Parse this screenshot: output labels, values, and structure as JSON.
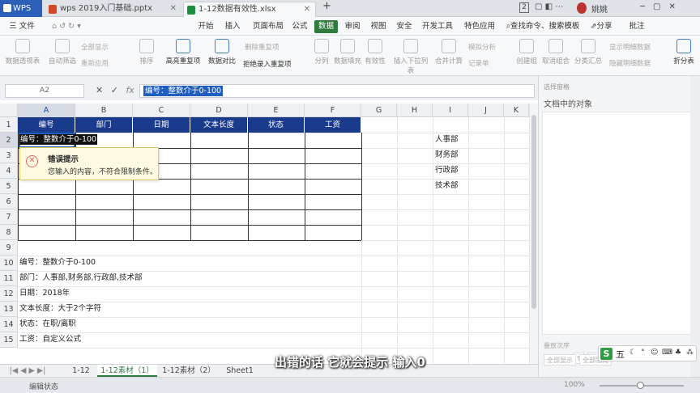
{
  "titlebar": {
    "logo": "WPS",
    "tabs": [
      {
        "label": "wps 2019入门基础.pptx",
        "icon": "presentation-file-icon",
        "color": "#d24726"
      },
      {
        "label": "1-12数据有效性.xlsx",
        "icon": "spreadsheet-file-icon",
        "color": "#1e8e3e"
      }
    ],
    "new_tab": "+",
    "page_badge": "2",
    "user": "姚姚"
  },
  "menubar": {
    "file": "三 文件",
    "items": [
      "开始",
      "插入",
      "页面布局",
      "公式",
      "数据",
      "审阅",
      "视图",
      "安全",
      "开发工具",
      "特色应用"
    ],
    "active": "数据",
    "search": "查找命令、搜索模板",
    "share": "分享",
    "annotate": "批注"
  },
  "ribbon": {
    "buttons": [
      {
        "label": "数据透视表",
        "enabled": false
      },
      {
        "label": "自动筛选",
        "enabled": false
      },
      {
        "label": "排序",
        "enabled": false
      },
      {
        "label": "高亮重复项",
        "enabled": true
      },
      {
        "label": "数据对比",
        "enabled": true
      },
      {
        "label": "拒绝录入重复项",
        "enabled": true
      },
      {
        "label": "分列",
        "enabled": false
      },
      {
        "label": "数据填充",
        "enabled": false
      },
      {
        "label": "有效性",
        "enabled": false
      },
      {
        "label": "插入下拉列表",
        "enabled": false
      },
      {
        "label": "合并计算",
        "enabled": false
      },
      {
        "label": "记录单",
        "enabled": false
      },
      {
        "label": "创建组",
        "enabled": false
      },
      {
        "label": "取消组合",
        "enabled": false
      },
      {
        "label": "分类汇总",
        "enabled": false
      },
      {
        "label": "折分表",
        "enabled": true
      }
    ],
    "small": [
      "全部显示",
      "重新应用",
      "删除重复项",
      "模拟分析",
      "显示明细数据",
      "隐藏明细数据"
    ]
  },
  "formulabar": {
    "cell_ref": "A2",
    "cancel": "✕",
    "confirm": "✓",
    "fx": "fx",
    "content": "编号：整数介于0-100"
  },
  "grid": {
    "columns": [
      "A",
      "B",
      "C",
      "D",
      "E",
      "F",
      "G",
      "H",
      "I",
      "J",
      "K"
    ],
    "selected_column": "A",
    "selected_row": "2",
    "rows": [
      "1",
      "2",
      "3",
      "4",
      "5",
      "6",
      "7",
      "8",
      "9",
      "10",
      "11",
      "12",
      "13",
      "14",
      "15"
    ],
    "table_headers": [
      "编号",
      "部门",
      "日期",
      "文本长度",
      "状态",
      "工资"
    ],
    "header_color": "#1a3a8c",
    "a2_value": "编号：整数介于0-100",
    "dept_list": [
      "人事部",
      "财务部",
      "行政部",
      "技术部"
    ],
    "notes": [
      "编号：整数介于0-100",
      "部门：人事部,财务部,行政部,技术部",
      "日期：2018年",
      "文本长度：大于2个字符",
      "状态：在职/离职",
      "工资：自定义公式"
    ]
  },
  "error_tip": {
    "title": "错误提示",
    "message": "您输入的内容，不符合限制条件。",
    "icon": "error-circle-icon"
  },
  "sheets": {
    "tabs": [
      "1-12",
      "1-12素材（1）",
      "1-12素材（2）",
      "Sheet1"
    ],
    "active": "1-12素材（1）"
  },
  "statusbar": {
    "mode": "编辑状态",
    "zoom": "100%"
  },
  "taskpane": {
    "title": "选择窗格",
    "subtitle": "文档中的对象",
    "order": "叠放次序",
    "show_all": "全部显示",
    "hide_all": "全部隐藏"
  },
  "subtitle": "出错的话 它就会提示 输入0",
  "ime": {
    "mode": "五"
  }
}
